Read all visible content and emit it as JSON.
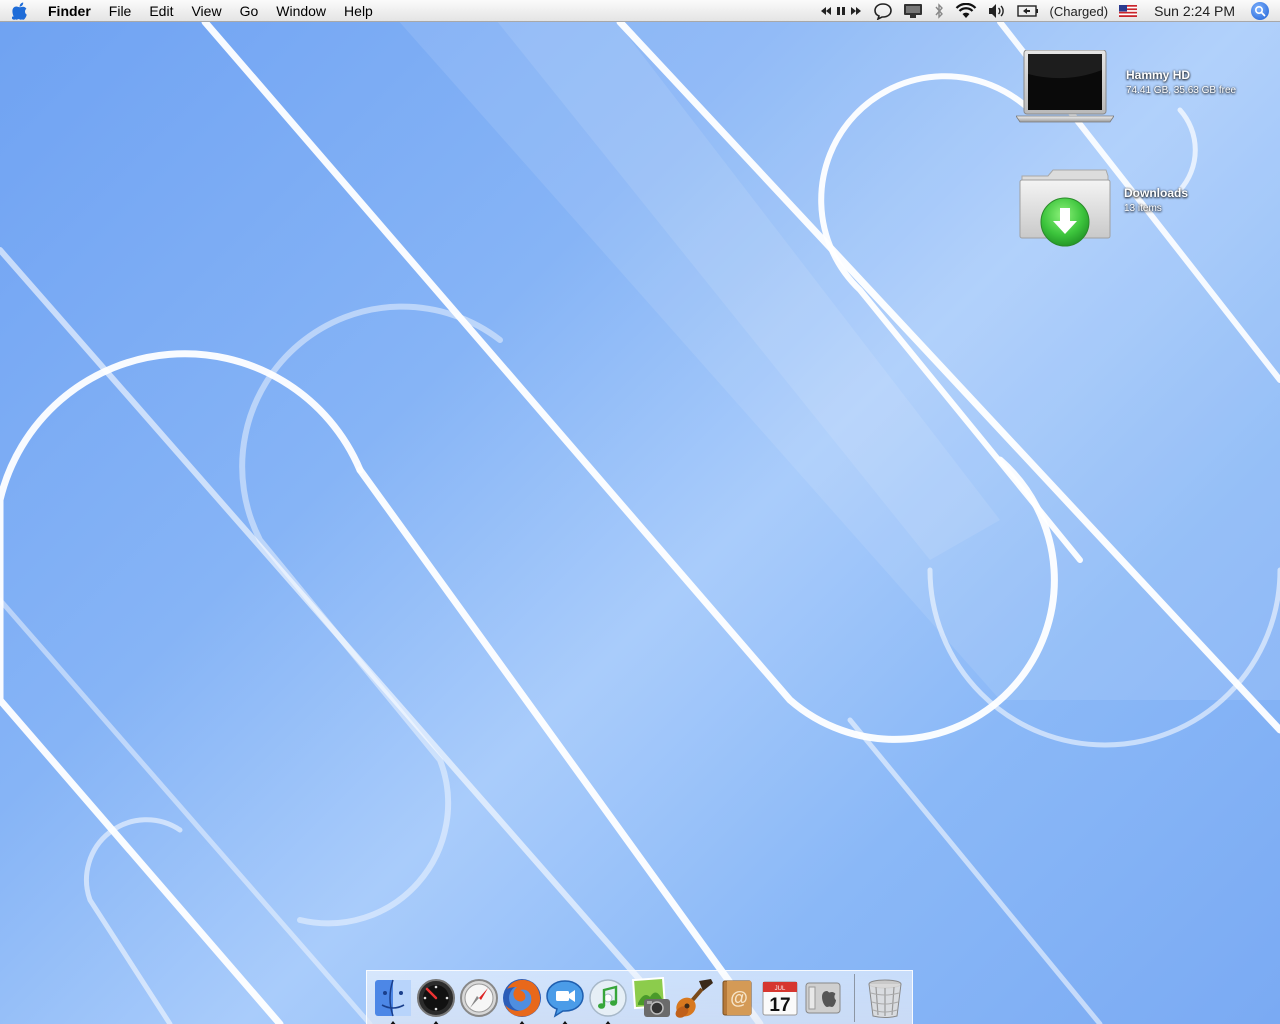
{
  "menubar": {
    "app_name": "Finder",
    "menus": [
      "File",
      "Edit",
      "View",
      "Go",
      "Window",
      "Help"
    ],
    "battery_status": "(Charged)",
    "clock": "Sun 2:24 PM",
    "status_icons": [
      "itunes-controls-icon",
      "ichat-status-icon",
      "display-icon",
      "bluetooth-icon",
      "wifi-icon",
      "volume-icon",
      "battery-icon",
      "us-flag-icon",
      "spotlight-icon"
    ]
  },
  "desktop": {
    "icons": [
      {
        "name": "Hammy HD",
        "info": "74.41 GB, 35.63 GB free",
        "icon": "macbook-drive-icon"
      },
      {
        "name": "Downloads",
        "info": "13 items",
        "icon": "downloads-folder-icon"
      }
    ]
  },
  "dock": {
    "apps": [
      {
        "name": "Finder",
        "icon": "finder-icon",
        "running": true
      },
      {
        "name": "Dashboard",
        "icon": "dashboard-icon",
        "running": true
      },
      {
        "name": "Safari",
        "icon": "safari-icon",
        "running": false
      },
      {
        "name": "Firefox",
        "icon": "firefox-icon",
        "running": true
      },
      {
        "name": "iChat",
        "icon": "ichat-icon",
        "running": true
      },
      {
        "name": "iTunes",
        "icon": "itunes-icon",
        "running": true
      },
      {
        "name": "iPhoto",
        "icon": "iphoto-icon",
        "running": false
      },
      {
        "name": "GarageBand",
        "icon": "garageband-icon",
        "running": false
      },
      {
        "name": "Address Book",
        "icon": "address-book-icon",
        "running": false
      },
      {
        "name": "iCal",
        "icon": "ical-icon",
        "running": false
      },
      {
        "name": "System Preferences",
        "icon": "system-preferences-icon",
        "running": false
      }
    ],
    "ical_day": "17",
    "ical_month": "JUL",
    "trash": {
      "icon": "trash-icon"
    }
  },
  "colors": {
    "desktop_blue": "#7aaaf3",
    "menubar": "#e9e9e9",
    "downloads_green": "#3cc43c"
  }
}
